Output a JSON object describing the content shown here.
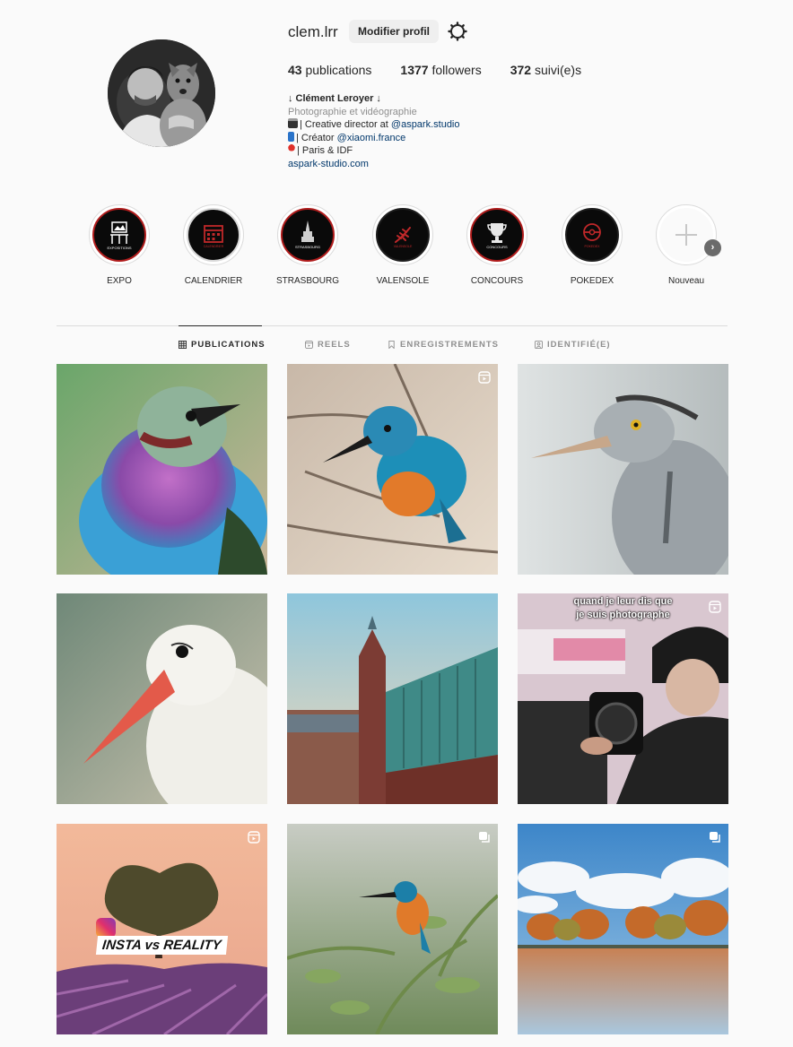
{
  "profile": {
    "username": "clem.lrr",
    "edit_label": "Modifier profil",
    "stats": [
      {
        "count": "43",
        "label": "publications"
      },
      {
        "count": "1377",
        "label": "followers"
      },
      {
        "count": "372",
        "label": "suivi(e)s"
      }
    ],
    "bio": {
      "name": "↓ Clément Leroyer ↓",
      "category": "Photographie et vidéographie",
      "line1_prefix": "| Creative director at ",
      "line1_mention": "@aspark.studio",
      "line2_prefix": "| Créator ",
      "line2_mention": "@xiaomi.france",
      "line3": "| Paris & IDF",
      "link": "aspark-studio.com"
    }
  },
  "highlights": [
    {
      "label": "EXPO",
      "icon": "exhibition-icon",
      "caption": "EXPOSITIONS"
    },
    {
      "label": "CALENDRIER",
      "icon": "calendar-icon",
      "caption": "CALENDRIER"
    },
    {
      "label": "STRASBOURG",
      "icon": "cathedral-icon",
      "caption": "STRASBOURG"
    },
    {
      "label": "VALENSOLE",
      "icon": "lavender-icon",
      "caption": "VALENSOLE"
    },
    {
      "label": "CONCOURS",
      "icon": "trophy-icon",
      "caption": "CONCOURS"
    },
    {
      "label": "POKEDEX",
      "icon": "pokeball-icon",
      "caption": "POKEDEX"
    },
    {
      "label": "Nouveau",
      "icon": "plus-icon",
      "caption": ""
    }
  ],
  "tabs": [
    {
      "label": "PUBLICATIONS",
      "icon": "grid-icon",
      "active": true
    },
    {
      "label": "REELS",
      "icon": "reels-icon",
      "active": false
    },
    {
      "label": "ENREGISTREMENTS",
      "icon": "bookmark-icon",
      "active": false
    },
    {
      "label": "IDENTIFIÉ(E)",
      "icon": "tagged-icon",
      "active": false
    }
  ],
  "posts": [
    {
      "subject": "lilac-breasted-roller",
      "badge": ""
    },
    {
      "subject": "kingfisher-on-branch",
      "badge": "reel-icon"
    },
    {
      "subject": "grey-heron",
      "badge": ""
    },
    {
      "subject": "white-stork",
      "badge": ""
    },
    {
      "subject": "strasbourg-cathedral",
      "badge": ""
    },
    {
      "subject": "photographer-reel",
      "badge": "reel-icon",
      "overlay": "quand je leur dis que\nje suis photographe"
    },
    {
      "subject": "lavender-tree",
      "badge": "reel-icon",
      "overlay": "INSTA vs REALITY"
    },
    {
      "subject": "kingfisher-perched",
      "badge": "carousel-icon"
    },
    {
      "subject": "autumn-lake",
      "badge": "carousel-icon"
    }
  ],
  "colors": {
    "accent_red": "#b01c1c",
    "link": "#00376b",
    "muted": "#8e8e8e"
  }
}
